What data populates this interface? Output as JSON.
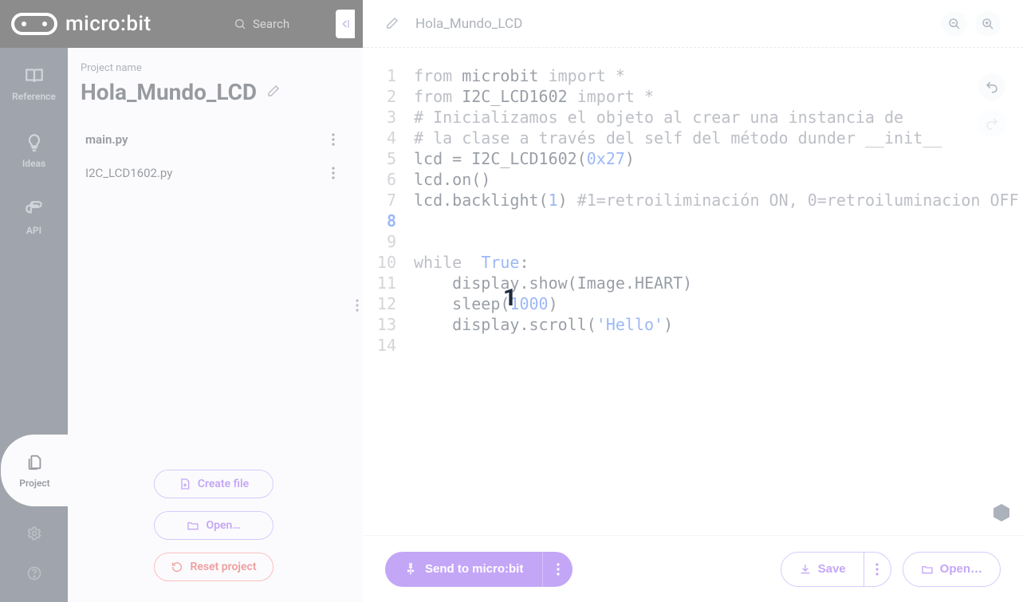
{
  "header": {
    "logo_text": "micro:bit",
    "search_placeholder": "Search"
  },
  "nav": {
    "reference": "Reference",
    "ideas": "Ideas",
    "api": "API",
    "project": "Project"
  },
  "project_panel": {
    "label": "Project name",
    "title": "Hola_Mundo_LCD",
    "files": [
      "main.py",
      "I2C_LCD1602.py"
    ],
    "create_file": "Create file",
    "open": "Open…",
    "reset": "Reset project"
  },
  "editor_header": {
    "tab_name": "Hola_Mundo_LCD"
  },
  "code": {
    "lines": [
      {
        "n": 1,
        "kw": "from",
        "mod": "microbit",
        "kw2": "import",
        "star": "*"
      },
      {
        "n": 2,
        "kw": "from",
        "mod": "I2C_LCD1602",
        "kw2": "import",
        "star": "*"
      },
      {
        "n": 3,
        "cmt": "# Inicializamos el objeto al crear una instancia de"
      },
      {
        "n": 4,
        "cmt": "# la clase a través del self del método dunder __init__"
      },
      {
        "n": 5,
        "plain": "lcd = I2C_LCD1602(",
        "num": "0x27",
        "tail": ")"
      },
      {
        "n": 6,
        "plain": "lcd.on()"
      },
      {
        "n": 7,
        "plain": "lcd.backlight(",
        "num": "1",
        "tail": ") ",
        "cmt": "#1=retroiliminación ON, 0=retroiluminacion OFF"
      },
      {
        "n": 8,
        "plain": ""
      },
      {
        "n": 9,
        "plain": ""
      },
      {
        "n": 10,
        "kw": "while",
        "bool": "True",
        "tail": ":"
      },
      {
        "n": 11,
        "indent": "    ",
        "plain": "display.show(Image.HEART)"
      },
      {
        "n": 12,
        "indent": "    ",
        "plain": "sleep(",
        "num": "1000",
        "tail": ")"
      },
      {
        "n": 13,
        "indent": "    ",
        "plain": "display.scroll(",
        "str": "'Hello'",
        "tail": ")"
      },
      {
        "n": 14,
        "plain": ""
      }
    ],
    "active_line": 8
  },
  "footer": {
    "send": "Send to micro:bit",
    "save": "Save",
    "open": "Open…"
  },
  "overlay": {
    "digit": "1"
  }
}
